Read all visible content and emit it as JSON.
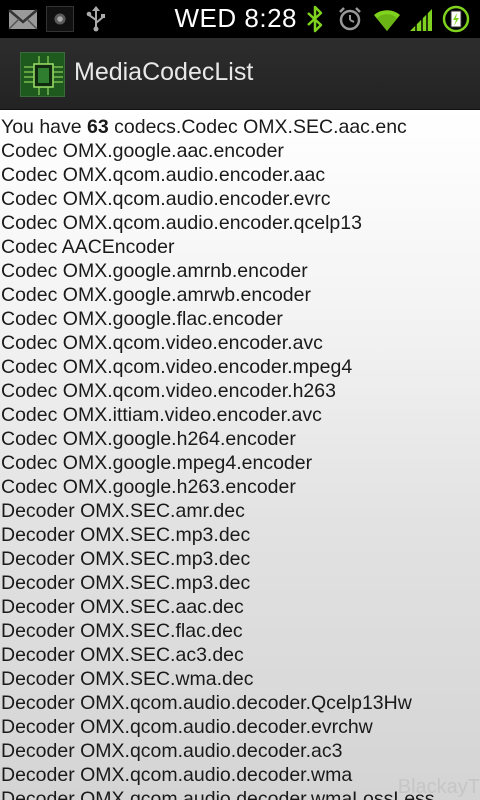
{
  "status_bar": {
    "time": "WED 8:28",
    "icons": [
      "gmail-icon",
      "photo-icon",
      "usb-icon",
      "bluetooth-icon",
      "alarm-icon",
      "wifi-icon",
      "signal-icon",
      "battery-charging-icon"
    ]
  },
  "action_bar": {
    "title": "MediaCodecList",
    "icon": "circuit-board-icon"
  },
  "content": {
    "summary_prefix": "You have ",
    "codec_count": "63",
    "summary_suffix": " codecs.Codec OMX.SEC.aac.enc",
    "lines": [
      "Codec OMX.google.aac.encoder",
      "Codec OMX.qcom.audio.encoder.aac",
      "Codec OMX.qcom.audio.encoder.evrc",
      "Codec OMX.qcom.audio.encoder.qcelp13",
      "Codec AACEncoder",
      "Codec OMX.google.amrnb.encoder",
      "Codec OMX.google.amrwb.encoder",
      "Codec OMX.google.flac.encoder",
      "Codec OMX.qcom.video.encoder.avc",
      "Codec OMX.qcom.video.encoder.mpeg4",
      "Codec OMX.qcom.video.encoder.h263",
      "Codec OMX.ittiam.video.encoder.avc",
      "Codec OMX.google.h264.encoder",
      "Codec OMX.google.mpeg4.encoder",
      "Codec OMX.google.h263.encoder",
      "Decoder OMX.SEC.amr.dec",
      "Decoder OMX.SEC.mp3.dec",
      "Decoder OMX.SEC.mp3.dec",
      "Decoder OMX.SEC.mp3.dec",
      "Decoder OMX.SEC.aac.dec",
      "Decoder OMX.SEC.flac.dec",
      "Decoder OMX.SEC.ac3.dec",
      "Decoder OMX.SEC.wma.dec",
      "Decoder OMX.qcom.audio.decoder.Qcelp13Hw",
      "Decoder OMX.qcom.audio.decoder.evrchw",
      "Decoder OMX.qcom.audio.decoder.ac3",
      "Decoder OMX.qcom.audio.decoder.wma",
      "Decoder OMX.qcom.audio.decoder.wmaLossLess"
    ],
    "watermark": "BlackayT"
  }
}
